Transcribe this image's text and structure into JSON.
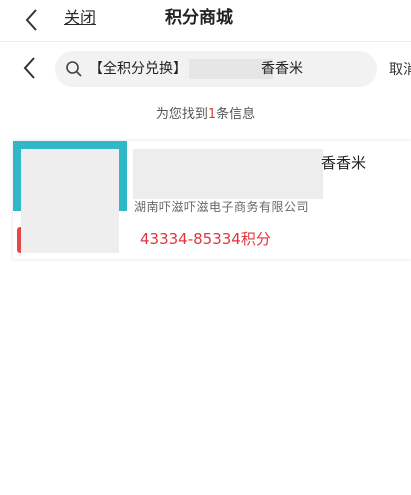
{
  "header": {
    "close_label": "关闭",
    "title": "积分商城"
  },
  "search": {
    "query_prefix": "【全积分兑换】",
    "query_suffix": "香香米",
    "cancel_label": "取消"
  },
  "results": {
    "info_prefix": "为您找到",
    "count": "1",
    "info_suffix": "条信息"
  },
  "products": [
    {
      "name": "香香米",
      "merchant": "湖南吓滋吓滋电子商务有限公司",
      "points": "43334-85334积分"
    }
  ],
  "colors": {
    "accent_red": "#e2363d",
    "thumb_teal": "#2fb8c7"
  }
}
